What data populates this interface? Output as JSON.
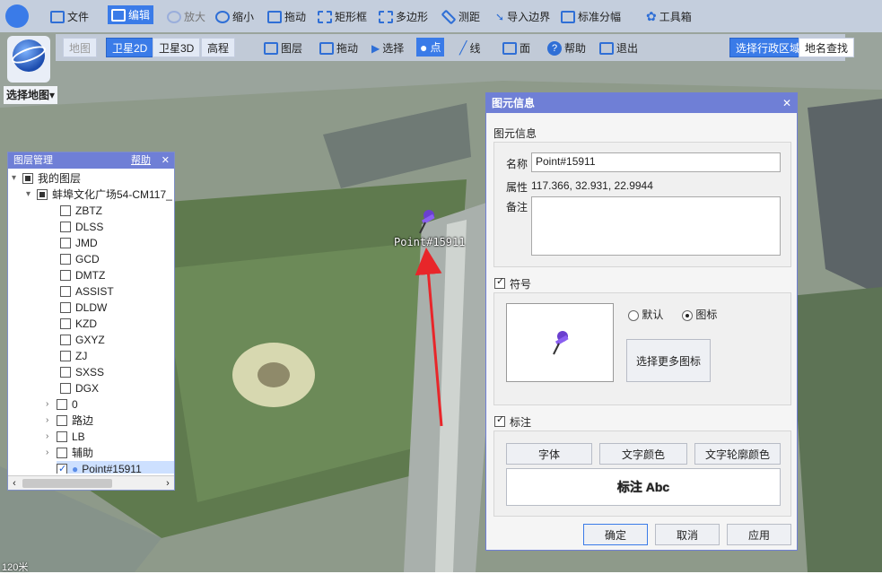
{
  "toolbar": {
    "file": "文件",
    "edit": "编辑",
    "zoom_in": "放大",
    "zoom_out": "缩小",
    "pan": "拖动",
    "rect": "矩形框",
    "polygon": "多边形",
    "measure": "测距",
    "import_border": "导入边界",
    "std_sheet": "标准分幅",
    "toolbox": "工具箱"
  },
  "toolbar2": {
    "map": "地图",
    "sat2d": "卫星2D",
    "sat3d": "卫星3D",
    "elevation": "高程",
    "layers": "图层",
    "pan": "拖动",
    "select": "选择",
    "point": "点",
    "line": "线",
    "area": "面",
    "help": "帮助",
    "exit": "退出",
    "select_region": "选择行政区域",
    "place_search": "地名查找"
  },
  "choose_map": "选择地图",
  "layer_panel": {
    "title": "图层管理",
    "help": "帮助",
    "close": "✕",
    "root": "我的图层",
    "group": "蚌埠文化广场54-CM117_",
    "items": [
      "ZBTZ",
      "DLSS",
      "JMD",
      "GCD",
      "DMTZ",
      "ASSIST",
      "DLDW",
      "KZD",
      "GXYZ",
      "ZJ",
      "SXSS",
      "DGX"
    ],
    "folders": [
      "0",
      "路边",
      "LB",
      "辅助"
    ],
    "point": "Point#15911"
  },
  "map_label": "Point#15911",
  "scale": "120米",
  "dialog": {
    "title": "图元信息",
    "close": "✕",
    "section": "图元信息",
    "name_label": "名称",
    "name_value": "Point#15911",
    "attr_label": "属性",
    "attr_value": "117.366, 32.931, 22.9944",
    "note_label": "备注",
    "symbol_label": "符号",
    "radio_default": "默认",
    "radio_icon": "图标",
    "more_icons": "选择更多图标",
    "annotation_label": "标注",
    "font_btn": "字体",
    "text_color_btn": "文字颜色",
    "outline_color_btn": "文字轮廓颜色",
    "preview": "标注 Abc",
    "ok": "确定",
    "cancel": "取消",
    "apply": "应用"
  },
  "colors": {
    "accent": "#3a7be8",
    "panel_header": "#6f7fd6",
    "arrow": "#e8262a"
  }
}
